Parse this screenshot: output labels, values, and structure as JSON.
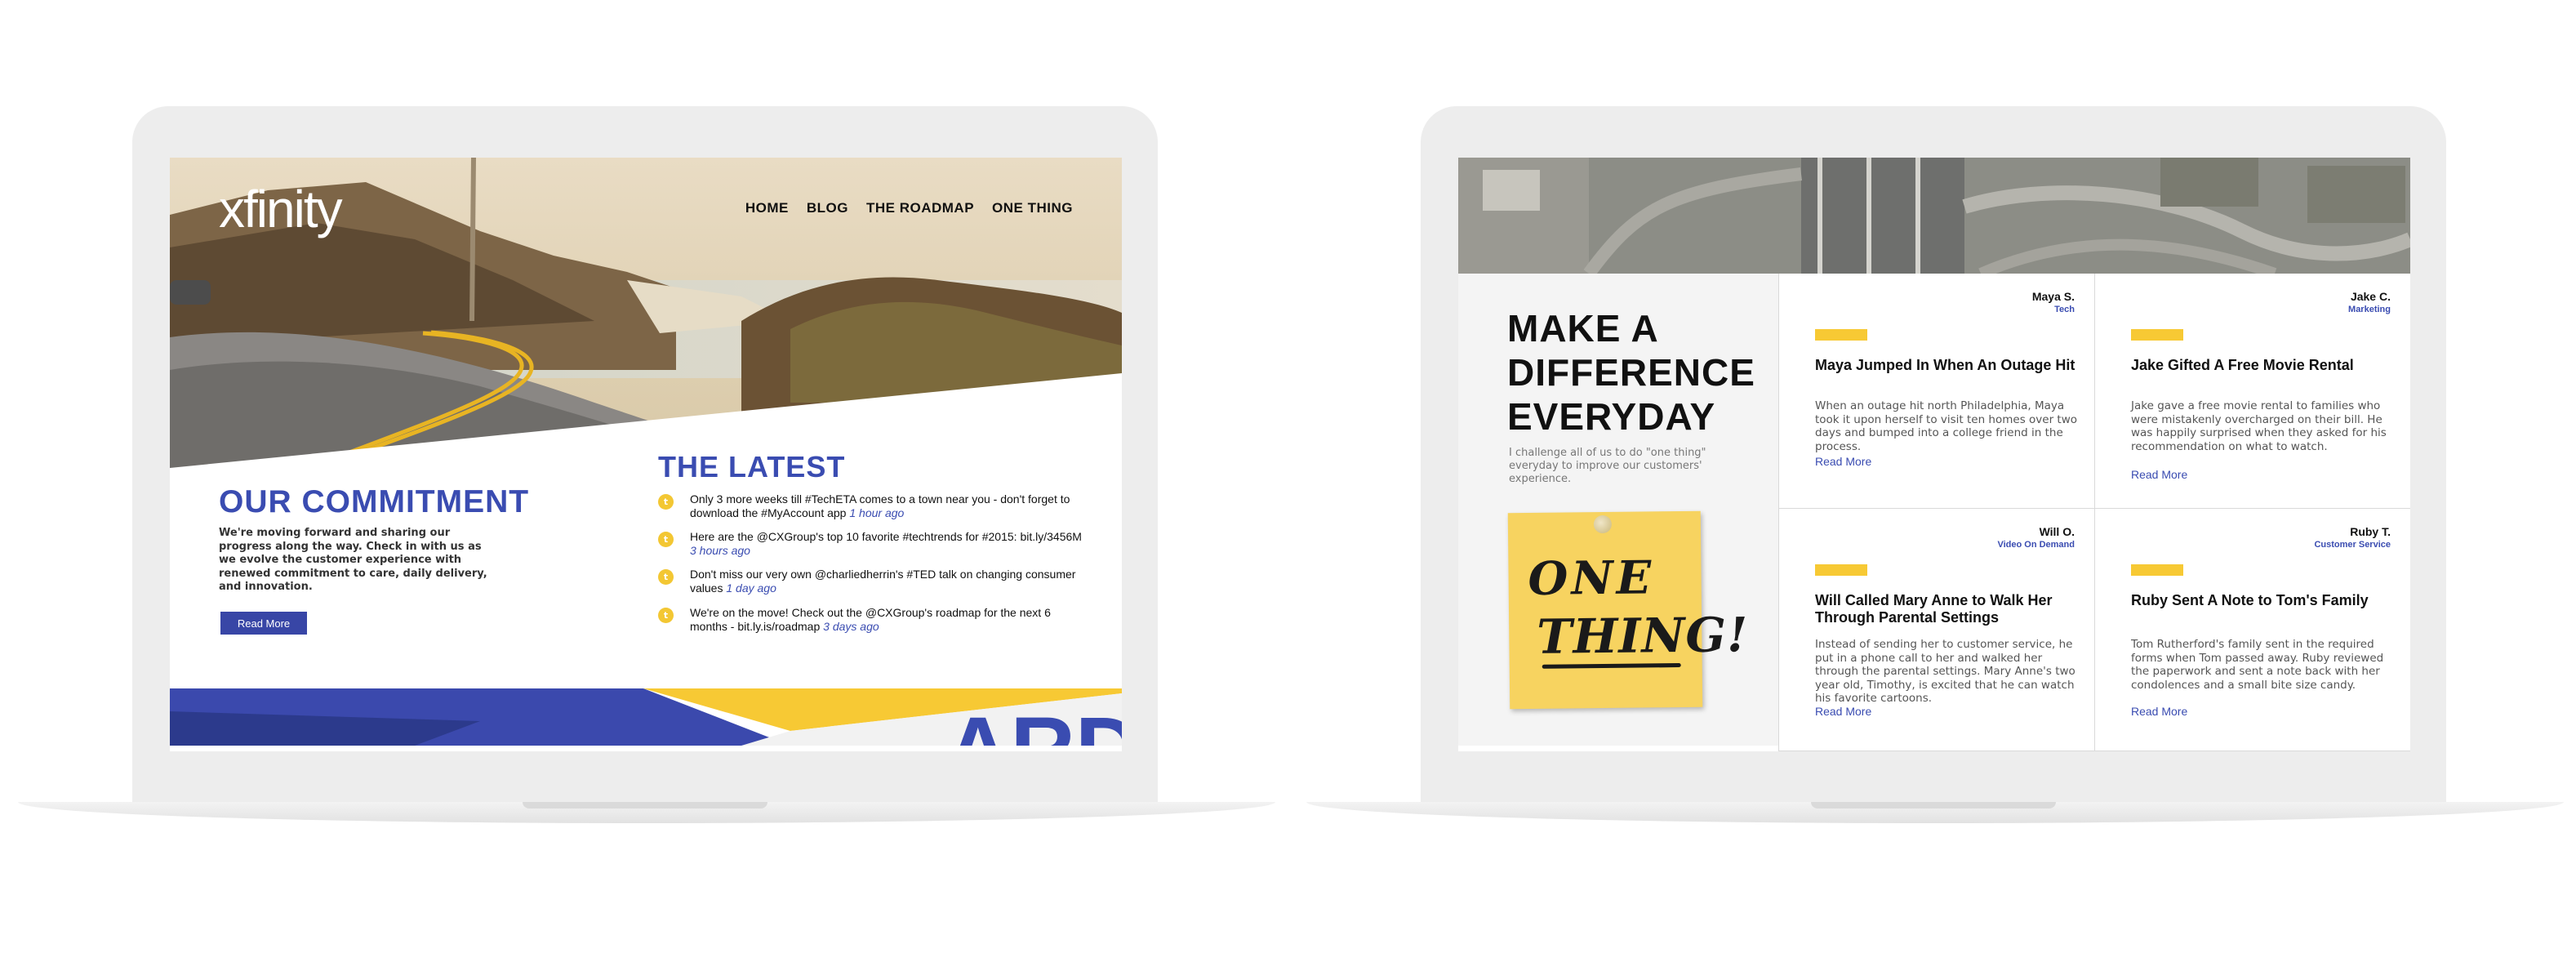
{
  "left_screen": {
    "logo": "xfinity",
    "nav": [
      "HOME",
      "BLOG",
      "THE ROADMAP",
      "ONE THING"
    ],
    "commitment": {
      "title": "OUR COMMITMENT",
      "body": "We're moving forward and sharing our progress along the way. Check in with us as we evolve the customer experience with renewed commitment to care, daily delivery, and innovation.",
      "button": "Read More"
    },
    "latest": {
      "title": "THE LATEST",
      "items": [
        {
          "text": "Only 3 more weeks till #TechETA comes to a town near you - don't forget to download the #MyAccount app",
          "time": "1 hour ago"
        },
        {
          "text": "Here are the @CXGroup's top 10 favorite #techtrends for #2015: bit.ly/3456M",
          "time": "3 hours ago"
        },
        {
          "text": "Don't miss our very own @charliedherrin's #TED talk on changing consumer values",
          "time": "1 day ago"
        },
        {
          "text": "We're on the move! Check out the @CXGroup's roadmap for the next 6 months - bit.ly.is/roadmap",
          "time": "3 days ago"
        }
      ]
    },
    "footer_partial_text": "ARD"
  },
  "right_screen": {
    "headline": [
      "MAKE A",
      "DIFFERENCE",
      "EVERYDAY"
    ],
    "challenge": "I challenge all of us to do \"one thing\" everyday to improve our customers' experience.",
    "sticky_note": [
      "ONE",
      "THING!"
    ],
    "cards": [
      {
        "name": "Maya S.",
        "role": "Tech",
        "title": "Maya Jumped In When An Outage Hit",
        "body": "When an outage hit north Philadelphia, Maya took it upon herself to visit ten homes over two days and bumped into a college friend in the process.",
        "more": "Read More"
      },
      {
        "name": "Jake C.",
        "role": "Marketing",
        "title": "Jake Gifted A Free Movie Rental",
        "body": "Jake gave a free movie rental to families who were mistakenly overcharged on their bill. He was happily surprised when they asked for his recommendation on what to watch.",
        "more": "Read More"
      },
      {
        "name": "Will O.",
        "role": "Video On Demand",
        "title": "Will Called Mary Anne to Walk Her Through Parental Settings",
        "body": "Instead of sending her to customer service, he put in a phone call to her and walked her through the parental settings. Mary Anne's two year old, Timothy, is excited that he can watch his favorite cartoons.",
        "more": "Read More"
      },
      {
        "name": "Ruby T.",
        "role": "Customer Service",
        "title": "Ruby Sent A Note to Tom's Family",
        "body": "Tom Rutherford's family sent in the required forms when Tom passed away. Ruby reviewed the paperwork and sent a note back with her condolences and a small bite size candy.",
        "more": "Read More"
      }
    ]
  },
  "colors": {
    "brand_blue": "#3a4cb1",
    "accent_yellow": "#f7c934",
    "frame_gray": "#ededed"
  }
}
